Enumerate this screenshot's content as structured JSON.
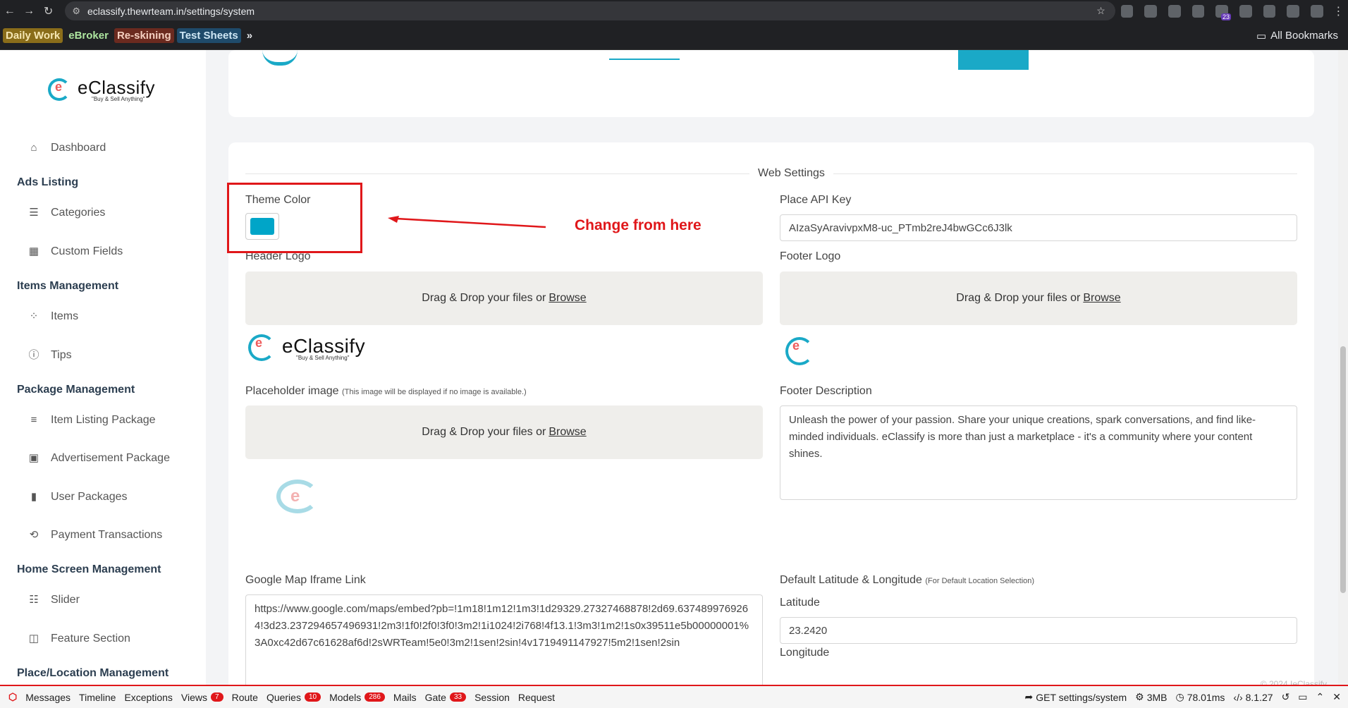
{
  "browser": {
    "url": "eclassify.thewrteam.in/settings/system",
    "extension_badge": "23",
    "bookmarks": [
      "Daily Work",
      "eBroker",
      "Re-skining",
      "Test Sheets"
    ],
    "all_bookmarks": "All Bookmarks",
    "more": "»"
  },
  "sidebar": {
    "brand": "eClassify",
    "tagline": "\"Buy & Sell Anything\"",
    "dashboard": "Dashboard",
    "ads_listing": "Ads Listing",
    "categories": "Categories",
    "custom_fields": "Custom Fields",
    "items_management": "Items Management",
    "items": "Items",
    "tips": "Tips",
    "package_management": "Package Management",
    "item_listing_package": "Item Listing Package",
    "advertisement_package": "Advertisement Package",
    "user_packages": "User Packages",
    "payment_transactions": "Payment Transactions",
    "home_screen_management": "Home Screen Management",
    "slider": "Slider",
    "feature_section": "Feature Section",
    "place_location_management": "Place/Location Management"
  },
  "web_settings": {
    "title": "Web Settings",
    "theme_color_label": "Theme Color",
    "theme_color": "#00a5c8",
    "annotation": "Change from here",
    "place_api_key_label": "Place API Key",
    "place_api_key": "AIzaSyAravivpxM8-uc_PTmb2reJ4bwGCc6J3lk",
    "header_logo_label": "Header Logo",
    "footer_logo_label": "Footer Logo",
    "drop_text": "Drag & Drop your files or",
    "browse": "Browse",
    "placeholder_label": "Placeholder image",
    "placeholder_note": "(This image will be displayed if no image is available.)",
    "footer_desc_label": "Footer Description",
    "footer_desc": "Unleash the power of your passion. Share your unique creations, spark conversations, and find like-minded individuals. eClassify is more than just a marketplace - it's a community where your content shines.",
    "map_label": "Google Map Iframe Link",
    "map_value": "https://www.google.com/maps/embed?pb=!1m18!1m12!1m3!1d29329.27327468878!2d69.6374899769264!3d23.237294657496931!2m3!1f0!2f0!3f0!3m2!1i1024!2i768!4f13.1!3m3!1m2!1s0x39511e5b00000001%3A0xc42d67c61628af6d!2sWRTeam!5e0!3m2!1sen!2sin!4v1719491147927!5m2!1sen!2sin",
    "latlng_label": "Default Latitude & Longitude",
    "latlng_note": "(For Default Location Selection)",
    "latitude_label": "Latitude",
    "latitude": "23.2420",
    "longitude_label": "Longitude",
    "copyright": "© 2024 IeClassify"
  },
  "debugbar": {
    "messages": "Messages",
    "timeline": "Timeline",
    "exceptions": "Exceptions",
    "views": "Views",
    "views_count": "7",
    "route": "Route",
    "queries": "Queries",
    "queries_count": "10",
    "models": "Models",
    "models_count": "286",
    "mails": "Mails",
    "gate": "Gate",
    "gate_count": "33",
    "session": "Session",
    "request": "Request",
    "route_info": "GET settings/system",
    "memory": "3MB",
    "time": "78.01ms",
    "php": "8.1.27"
  }
}
